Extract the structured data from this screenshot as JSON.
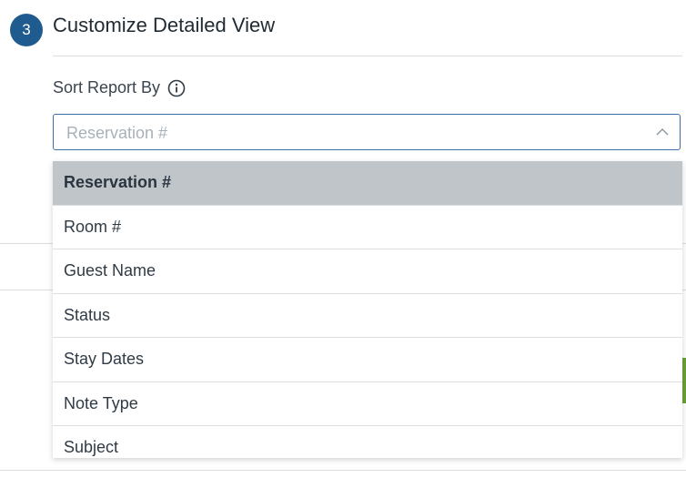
{
  "section": {
    "step_number": "3",
    "title": "Customize Detailed View"
  },
  "sort": {
    "label": "Sort Report By",
    "placeholder": "Reservation #",
    "selected": "Reservation #",
    "options": [
      "Reservation #",
      "Room #",
      "Guest Name",
      "Status",
      "Stay Dates",
      "Note Type",
      "Subject"
    ]
  },
  "colors": {
    "badge": "#1f5b8f",
    "focus_border": "#3b6ea5",
    "selected_option_bg": "#bfc5c8",
    "accent_green": "#6aa338"
  },
  "icons": {
    "info": "info-icon",
    "dropdown_chevron": "chevron-up-icon"
  }
}
